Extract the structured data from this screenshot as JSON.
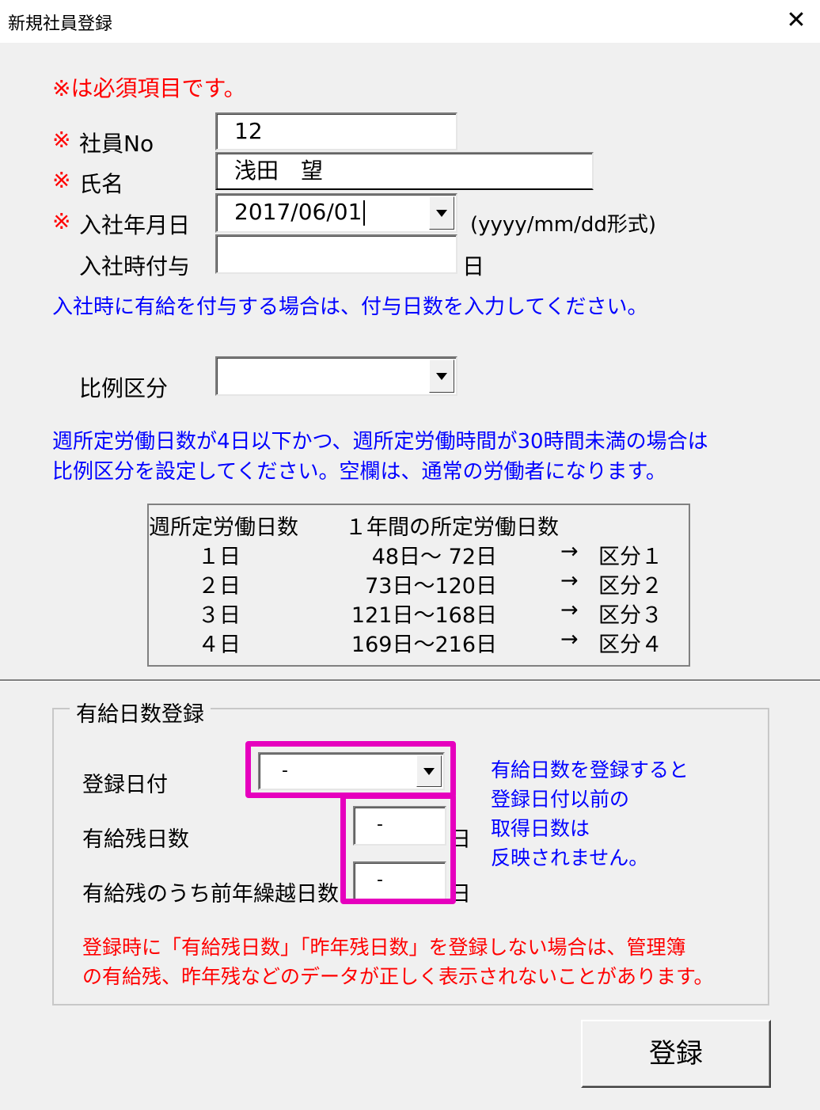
{
  "window": {
    "title": "新規社員登録",
    "close_glyph": "✕"
  },
  "required_note": "※は必須項目です。",
  "mark": "※",
  "fields": {
    "employee_no": {
      "label": "社員No",
      "value": "12"
    },
    "name": {
      "label": "氏名",
      "value": "浅田　望"
    },
    "hire_date": {
      "label": "入社年月日",
      "value": "2017/06/01",
      "format_hint": "(yyyy/mm/dd形式)"
    },
    "hire_grant": {
      "label": "入社時付与",
      "value": "",
      "unit": "日"
    }
  },
  "grant_note": "入社時に有給を付与する場合は、付与日数を入力してください。",
  "proportional": {
    "label": "比例区分",
    "value": ""
  },
  "proportional_note": [
    "週所定労働日数が4日以下かつ、週所定労働時間が30時間未満の場合は",
    "比例区分を設定してください。空欄は、通常の労働者になります。"
  ],
  "table": {
    "headers": [
      "週所定労働日数",
      "１年間の所定労働日数"
    ],
    "arrow": "→",
    "rows": [
      {
        "days": "１日",
        "range": "48日～  72日",
        "category": "区分１"
      },
      {
        "days": "２日",
        "range": "73日～120日",
        "category": "区分２"
      },
      {
        "days": "３日",
        "range": "121日～168日",
        "category": "区分３"
      },
      {
        "days": "４日",
        "range": "169日～216日",
        "category": "区分４"
      }
    ]
  },
  "paid_leave": {
    "title": "有給日数登録",
    "reg_date": {
      "label": "登録日付",
      "value": "-"
    },
    "remaining": {
      "label": "有給残日数",
      "value": "-",
      "unit": "日"
    },
    "carryover": {
      "label": "有給残のうち前年繰越日数",
      "value": "-",
      "unit": "日"
    },
    "side_note": [
      "有給日数を登録すると",
      "登録日付以前の",
      "取得日数は",
      "反映されません。"
    ],
    "warning": [
      "登録時に「有給残日数」「昨年残日数」を登録しない場合は、管理簿",
      "の有給残、昨年残などのデータが正しく表示されないことがあります。"
    ]
  },
  "register_button": "登録",
  "colors": {
    "required": "#ff0000",
    "note": "#0000ff",
    "highlight": "#e600be"
  }
}
